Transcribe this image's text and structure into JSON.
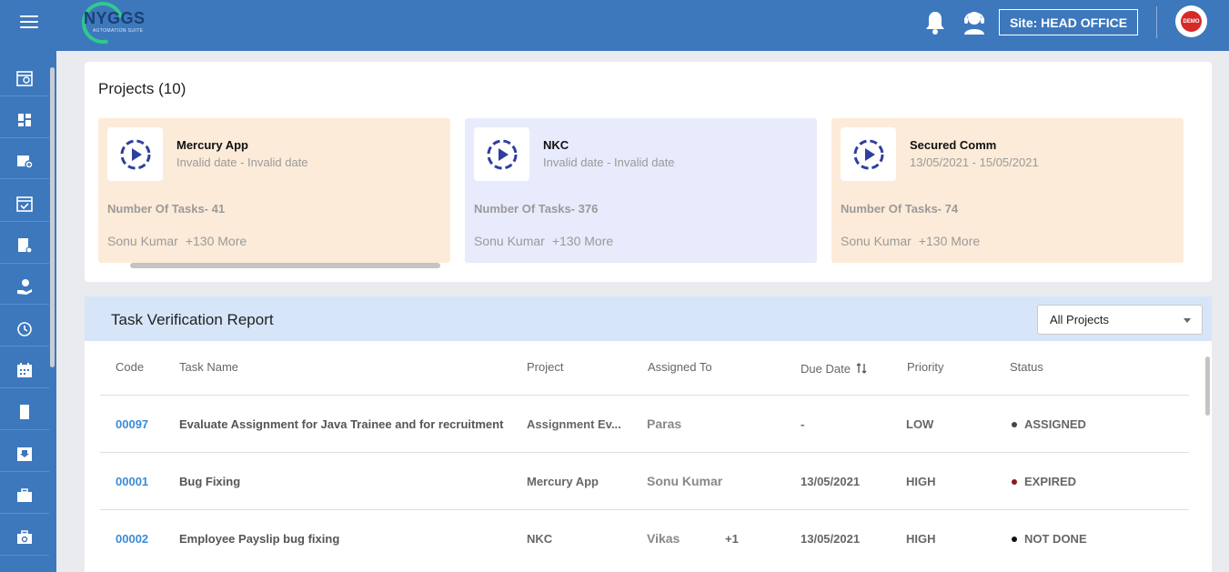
{
  "header": {
    "logo_text": "NYGGS",
    "logo_subtext": "AUTOMATION SUITE",
    "site_label": "Site: HEAD OFFICE",
    "avatar_text": "DEMO",
    "icons": [
      "menu-icon",
      "bell-icon",
      "support-agent-icon"
    ]
  },
  "sidebar": {
    "items": [
      {
        "icon": "calendar-report-icon"
      },
      {
        "icon": "dashboard-icon"
      },
      {
        "icon": "add-project-icon"
      },
      {
        "icon": "task-check-icon"
      },
      {
        "icon": "document-settings-icon"
      },
      {
        "icon": "hand-money-icon"
      },
      {
        "icon": "timer-icon"
      },
      {
        "icon": "calendar-icon"
      },
      {
        "icon": "page-icon"
      },
      {
        "icon": "inbox-download-icon"
      },
      {
        "icon": "briefcase-icon"
      },
      {
        "icon": "toolbox-icon"
      }
    ]
  },
  "projects": {
    "title": "Projects (10)",
    "cards": [
      {
        "name": "Mercury App",
        "dates": "Invalid date - Invalid date",
        "tasks": "Number Of Tasks- 41",
        "member": "Sonu Kumar",
        "more": "+130 More",
        "bg": "#fdebd9"
      },
      {
        "name": "NKC",
        "dates": "Invalid date - Invalid date",
        "tasks": "Number Of Tasks- 376",
        "member": "Sonu Kumar",
        "more": "+130 More",
        "bg": "#e8ebfb"
      },
      {
        "name": "Secured Comm",
        "dates": "13/05/2021 - 15/05/2021",
        "tasks": "Number Of Tasks- 74",
        "member": "Sonu Kumar",
        "more": "+130 More",
        "bg": "#fdebd9"
      }
    ]
  },
  "task_report": {
    "title": "Task Verification Report",
    "filter_value": "All Projects",
    "columns": {
      "code": "Code",
      "task_name": "Task Name",
      "project": "Project",
      "assigned_to": "Assigned To",
      "due_date": "Due Date",
      "priority": "Priority",
      "status": "Status"
    },
    "rows": [
      {
        "code": "00097",
        "task_name": "Evaluate Assignment for Java Trainee and for recruitment",
        "project": "Assignment Ev...",
        "assigned_to": "Paras",
        "extra": "",
        "due_date": "-",
        "priority": "LOW",
        "status": "ASSIGNED",
        "status_color": "#444444"
      },
      {
        "code": "00001",
        "task_name": "Bug Fixing",
        "project": "Mercury App",
        "assigned_to": "Sonu Kumar",
        "extra": "",
        "due_date": "13/05/2021",
        "priority": "HIGH",
        "status": "EXPIRED",
        "status_color": "#8b1a1a"
      },
      {
        "code": "00002",
        "task_name": "Employee Payslip bug fixing",
        "project": "NKC",
        "assigned_to": "Vikas",
        "extra": "+1",
        "due_date": "13/05/2021",
        "priority": "HIGH",
        "status": "NOT DONE",
        "status_color": "#111111"
      }
    ]
  },
  "colors": {
    "primary": "#3d78bd",
    "link": "#3b8bd6",
    "header_band": "#d6e6f8"
  }
}
